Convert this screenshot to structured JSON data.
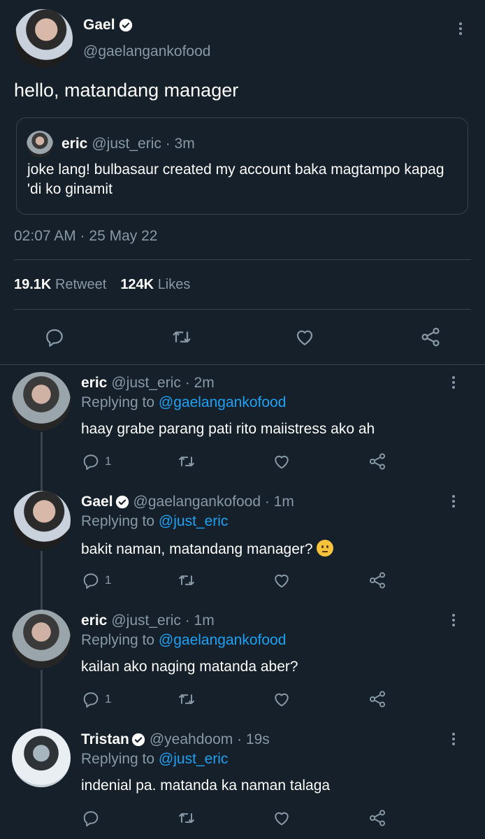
{
  "main_tweet": {
    "name": "Gael",
    "handle": "@gaelangankofood",
    "text": "hello, matandang manager",
    "quote": {
      "name": "eric",
      "meta": "@just_eric · 3m",
      "text": "joke lang! bulbasaur created my account baka magtampo kapag 'di ko ginamit"
    },
    "timestamp": "02:07 AM · 25 May 22",
    "retweets_count": "19.1K",
    "retweets_label": "Retweet",
    "likes_count": "124K",
    "likes_label": "Likes"
  },
  "replies": [
    {
      "name": "eric",
      "verified": false,
      "meta": "@just_eric · 2m",
      "replying_label": "Replying to",
      "replying_to": "@gaelangankofood",
      "text": "haay grabe parang pati rito maiistress ako ah",
      "reply_count": "1"
    },
    {
      "name": "Gael",
      "verified": true,
      "meta": "@gaelangankofood · 1m",
      "replying_label": "Replying to",
      "replying_to": "@just_eric",
      "text": "bakit naman, matandang manager?",
      "reply_count": "1"
    },
    {
      "name": "eric",
      "verified": false,
      "meta": "@just_eric · 1m",
      "replying_label": "Replying to",
      "replying_to": "@gaelangankofood",
      "text": "kailan ako naging matanda aber?",
      "reply_count": "1"
    },
    {
      "name": "Tristan",
      "verified": true,
      "meta": "@yeahdoom · 19s",
      "replying_label": "Replying to",
      "replying_to": "@just_eric",
      "text": "indenial pa. matanda ka naman talaga",
      "reply_count": ""
    }
  ],
  "colors": {
    "background": "#15202b",
    "muted": "#8899a6",
    "link": "#1da1f2",
    "border": "#38444d"
  }
}
